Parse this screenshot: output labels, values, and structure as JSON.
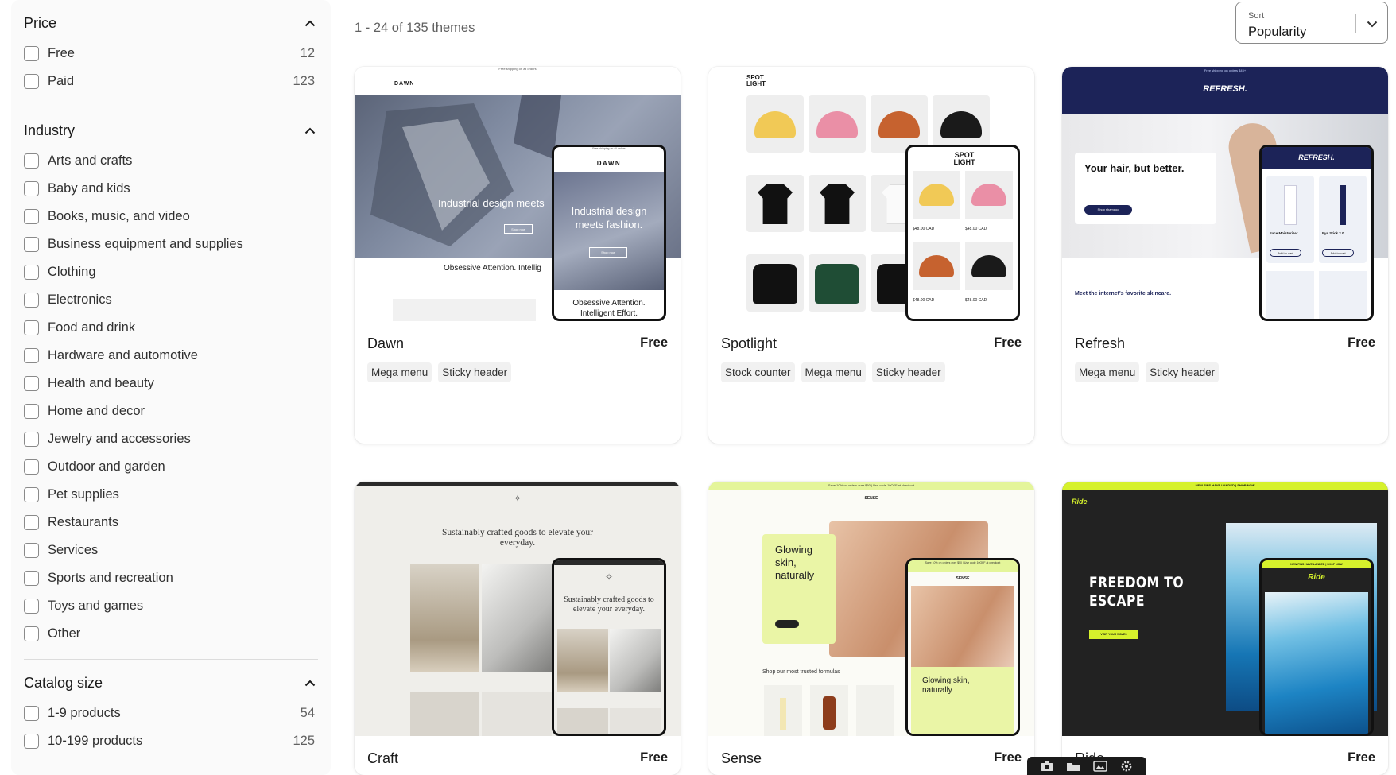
{
  "filters": {
    "price": {
      "title": "Price",
      "options": [
        {
          "label": "Free",
          "count": "12"
        },
        {
          "label": "Paid",
          "count": "123"
        }
      ]
    },
    "industry": {
      "title": "Industry",
      "options": [
        {
          "label": "Arts and crafts"
        },
        {
          "label": "Baby and kids"
        },
        {
          "label": "Books, music, and video"
        },
        {
          "label": "Business equipment and supplies"
        },
        {
          "label": "Clothing"
        },
        {
          "label": "Electronics"
        },
        {
          "label": "Food and drink"
        },
        {
          "label": "Hardware and automotive"
        },
        {
          "label": "Health and beauty"
        },
        {
          "label": "Home and decor"
        },
        {
          "label": "Jewelry and accessories"
        },
        {
          "label": "Outdoor and garden"
        },
        {
          "label": "Pet supplies"
        },
        {
          "label": "Restaurants"
        },
        {
          "label": "Services"
        },
        {
          "label": "Sports and recreation"
        },
        {
          "label": "Toys and games"
        },
        {
          "label": "Other"
        }
      ]
    },
    "catalog": {
      "title": "Catalog size",
      "options": [
        {
          "label": "1-9 products",
          "count": "54"
        },
        {
          "label": "10-199 products",
          "count": "125"
        }
      ]
    }
  },
  "results": {
    "count_text": "1 - 24 of 135 themes"
  },
  "sort": {
    "label": "Sort",
    "value": "Popularity"
  },
  "themes": [
    {
      "name": "Dawn",
      "price": "Free",
      "tags": [
        "Mega menu",
        "Sticky header"
      ],
      "preview": {
        "brand": "DAWN",
        "hero": "Industrial design meets fashion.",
        "hero_short": "Industrial design meets",
        "sub": "Obsessive Attention. Intelligent Effort.",
        "sub_short": "Obsessive Attention. Intellig",
        "button": "Shop now",
        "banner": "Free shipping on all orders"
      }
    },
    {
      "name": "Spotlight",
      "price": "Free",
      "tags": [
        "Stock counter",
        "Mega menu",
        "Sticky header"
      ],
      "preview": {
        "brand": "SPOT LIGHT",
        "price_tag": "$48.00 CAD"
      }
    },
    {
      "name": "Refresh",
      "price": "Free",
      "tags": [
        "Mega menu",
        "Sticky header"
      ],
      "preview": {
        "brand": "REFRESH.",
        "hero": "Your hair, but better.",
        "button": "Shop shampoo",
        "sub": "Meet the internet's favorite skincare.",
        "cart": "Add to cart",
        "product1": "Face Moisturizer",
        "product2": "Eye Stick 2.0",
        "banner": "Free shipping on orders $45+"
      }
    },
    {
      "name": "Craft",
      "price": "Free",
      "tags": [],
      "preview": {
        "hero": "Sustainably crafted goods to elevate your everyday.",
        "hero_phone": "Sustainably crafted goods to elevate your everyday."
      }
    },
    {
      "name": "Sense",
      "price": "Free",
      "tags": [],
      "preview": {
        "brand": "SENSE",
        "hero": "Glowing skin, naturally",
        "sub": "Shop our most trusted formulas",
        "banner": "Save 10% on orders over $50 | Use code 10OFF at checkout"
      }
    },
    {
      "name": "Ride",
      "price": "Free",
      "tags": [],
      "preview": {
        "brand": "Ride",
        "hero": "FREEDOM TO ESCAPE",
        "banner": "NEW FINS HAVE LANDED | SHOP NOW",
        "banner_phone": "NEW FINS HAVE LANDED | SHOP NOW",
        "button": "VISIT YOUR WAVES"
      }
    }
  ],
  "colors": {
    "refresh_navy": "#1c2358",
    "sense_lime": "#e4f59a",
    "ride_lime": "#d6f12c",
    "ride_dark": "#222222"
  }
}
